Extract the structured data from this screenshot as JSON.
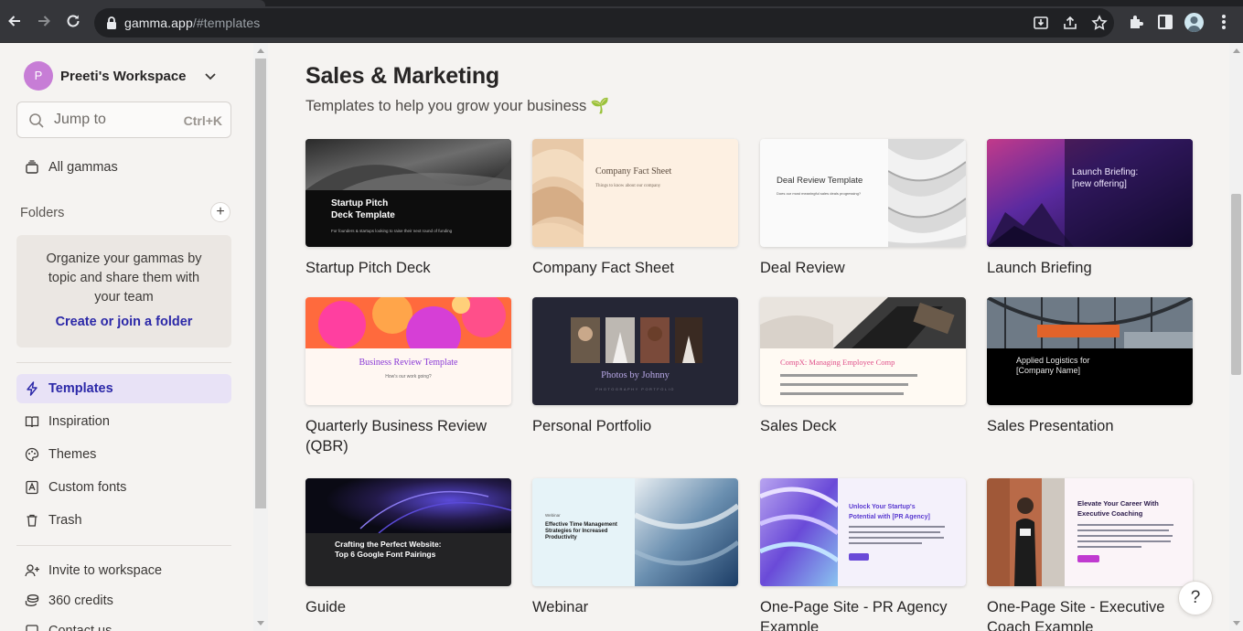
{
  "browser": {
    "url_host": "gamma.app",
    "url_path": "/#templates"
  },
  "sidebar": {
    "workspace_initial": "P",
    "workspace_name": "Preeti's Workspace",
    "search_placeholder": "Jump to",
    "search_shortcut": "Ctrl+K",
    "all_gammas": "All gammas",
    "folders_heading": "Folders",
    "folder_card": {
      "message": "Organize your gammas by topic and share them with your team",
      "cta": "Create or join a folder"
    },
    "nav": [
      {
        "label": "Templates",
        "icon": "lightning-icon",
        "active": true
      },
      {
        "label": "Inspiration",
        "icon": "book-icon",
        "active": false
      },
      {
        "label": "Themes",
        "icon": "palette-icon",
        "active": false
      },
      {
        "label": "Custom fonts",
        "icon": "font-icon",
        "active": false
      },
      {
        "label": "Trash",
        "icon": "trash-icon",
        "active": false
      }
    ],
    "footer": [
      {
        "label": "Invite to workspace",
        "icon": "user-plus-icon"
      },
      {
        "label": "360 credits",
        "icon": "coins-icon"
      },
      {
        "label": "Contact us",
        "icon": "contact-icon"
      }
    ]
  },
  "main": {
    "title": "Sales & Marketing",
    "subtitle": "Templates to help you grow your business 🌱",
    "templates": [
      {
        "label": "Startup Pitch Deck",
        "thumb_title": "Startup Pitch\nDeck Template",
        "thumb_sub": "For founders & startups looking to raise their next round of funding"
      },
      {
        "label": "Company Fact Sheet",
        "thumb_title": "Company Fact Sheet",
        "thumb_sub": "Things to know about our company"
      },
      {
        "label": "Deal Review",
        "thumb_title": "Deal Review Template",
        "thumb_sub": "Does our most meaningful sales deals progressing?"
      },
      {
        "label": "Launch Briefing",
        "thumb_title": "Launch Briefing:\n[new offering]",
        "thumb_sub": ""
      },
      {
        "label": "Quarterly Business Review (QBR)",
        "thumb_title": "Business Review Template",
        "thumb_sub": "How's our work going?"
      },
      {
        "label": "Personal Portfolio",
        "thumb_title": "Photos by Johnny",
        "thumb_sub": "PHOTOGRAPHY PORTFOLIO"
      },
      {
        "label": "Sales Deck",
        "thumb_title": "CompX: Managing Employee Comp",
        "thumb_sub": ""
      },
      {
        "label": "Sales Presentation",
        "thumb_title": "Applied Logistics for\n[Company Name]",
        "thumb_sub": ""
      },
      {
        "label": "Guide",
        "thumb_title": "Crafting the Perfect Website:\nTop 6 Google Font Pairings",
        "thumb_sub": ""
      },
      {
        "label": "Webinar",
        "thumb_title": "Effective Time Management\nStrategies for Increased\nProductivity",
        "thumb_sub": "Webinar"
      },
      {
        "label": "One-Page Site - PR Agency Example",
        "thumb_title": "Unlock Your Startup's\nPotential with [PR Agency]",
        "thumb_sub": ""
      },
      {
        "label": "One-Page Site - Executive Coach Example",
        "thumb_title": "Elevate Your Career With\nExecutive Coaching",
        "thumb_sub": ""
      }
    ]
  },
  "help_label": "?",
  "colors": {
    "accent": "#2b28a8",
    "active_bg": "#e8e2f6",
    "avatar": "#c77dd6",
    "page_bg": "#f5f3f1"
  }
}
